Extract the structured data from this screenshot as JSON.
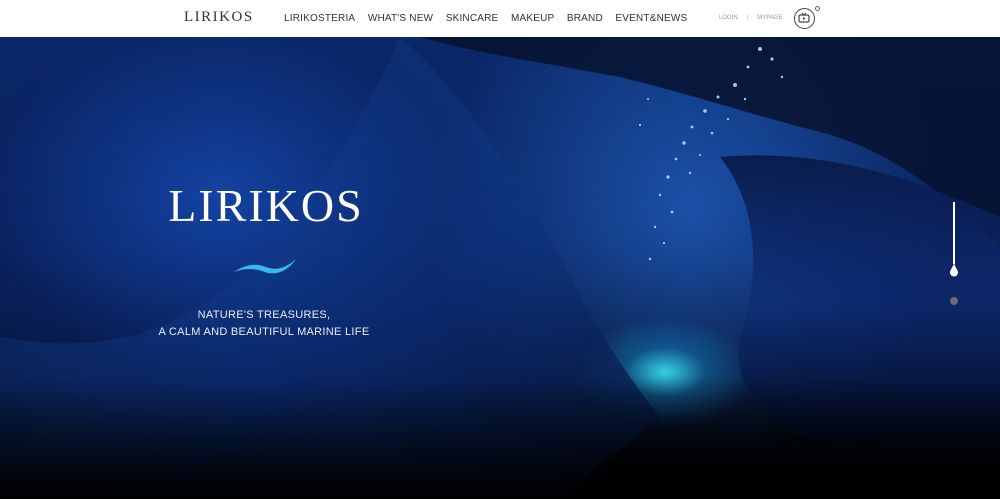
{
  "header": {
    "logo": "LIRIKOS",
    "nav": [
      "LIRIKOSTERIA",
      "WHAT'S NEW",
      "SKINCARE",
      "MAKEUP",
      "BRAND",
      "EVENT&NEWS"
    ],
    "login": "LOGIN",
    "separator": "|",
    "mypage": "MYPAGE",
    "tv_icon": "tv-icon"
  },
  "hero": {
    "title": "LIRIKOS",
    "wave_icon": "wave-icon",
    "tagline_line1": "NATURE'S TREASURES,",
    "tagline_line2": "A CALM AND BEAUTIFUL MARINE  LIFE",
    "slides_total": 2,
    "active_slide": 1
  },
  "colors": {
    "accent": "#3ab8e8",
    "header_bg": "#ffffff",
    "hero_deep": "#0a2058"
  }
}
